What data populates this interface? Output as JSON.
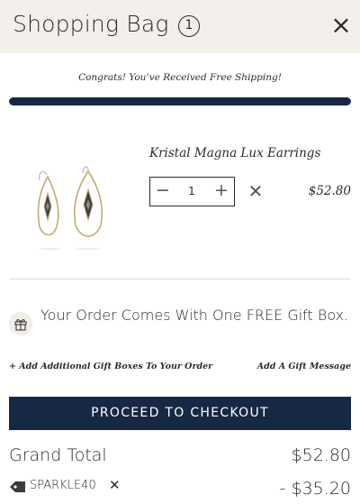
{
  "header": {
    "title": "Shopping Bag",
    "item_count": "1",
    "close_icon": "close-icon",
    "close_symbol": "×"
  },
  "shipping": {
    "message": "Congrats! You’ve Received Free Shipping!",
    "progress": 1.0
  },
  "cart": {
    "items": [
      {
        "name": "Kristal Magna Lux Earrings",
        "quantity": "1",
        "price": "$52.80",
        "image_icon": "earrings-image",
        "minus_symbol": "−",
        "plus_symbol": "+",
        "remove_symbol": "✕"
      }
    ]
  },
  "gift": {
    "icon": "gift-icon",
    "message": "Your Order Comes With One FREE Gift Box.",
    "add_boxes_label": "+ Add Additional Gift Boxes To Your Order",
    "add_message_label": "Add A Gift Message"
  },
  "checkout": {
    "button_label": "PROCEED TO CHECKOUT"
  },
  "totals": {
    "grand_total_label": "Grand Total",
    "grand_total_value": "$52.80",
    "coupon_code": "SPARKLE40",
    "coupon_icon": "tag-icon",
    "coupon_remove_symbol": "✕",
    "discount_value": "- $35.20"
  },
  "colors": {
    "brand_navy": "#172845",
    "header_bg": "#f3f0ec",
    "text": "#2b2b2b"
  }
}
